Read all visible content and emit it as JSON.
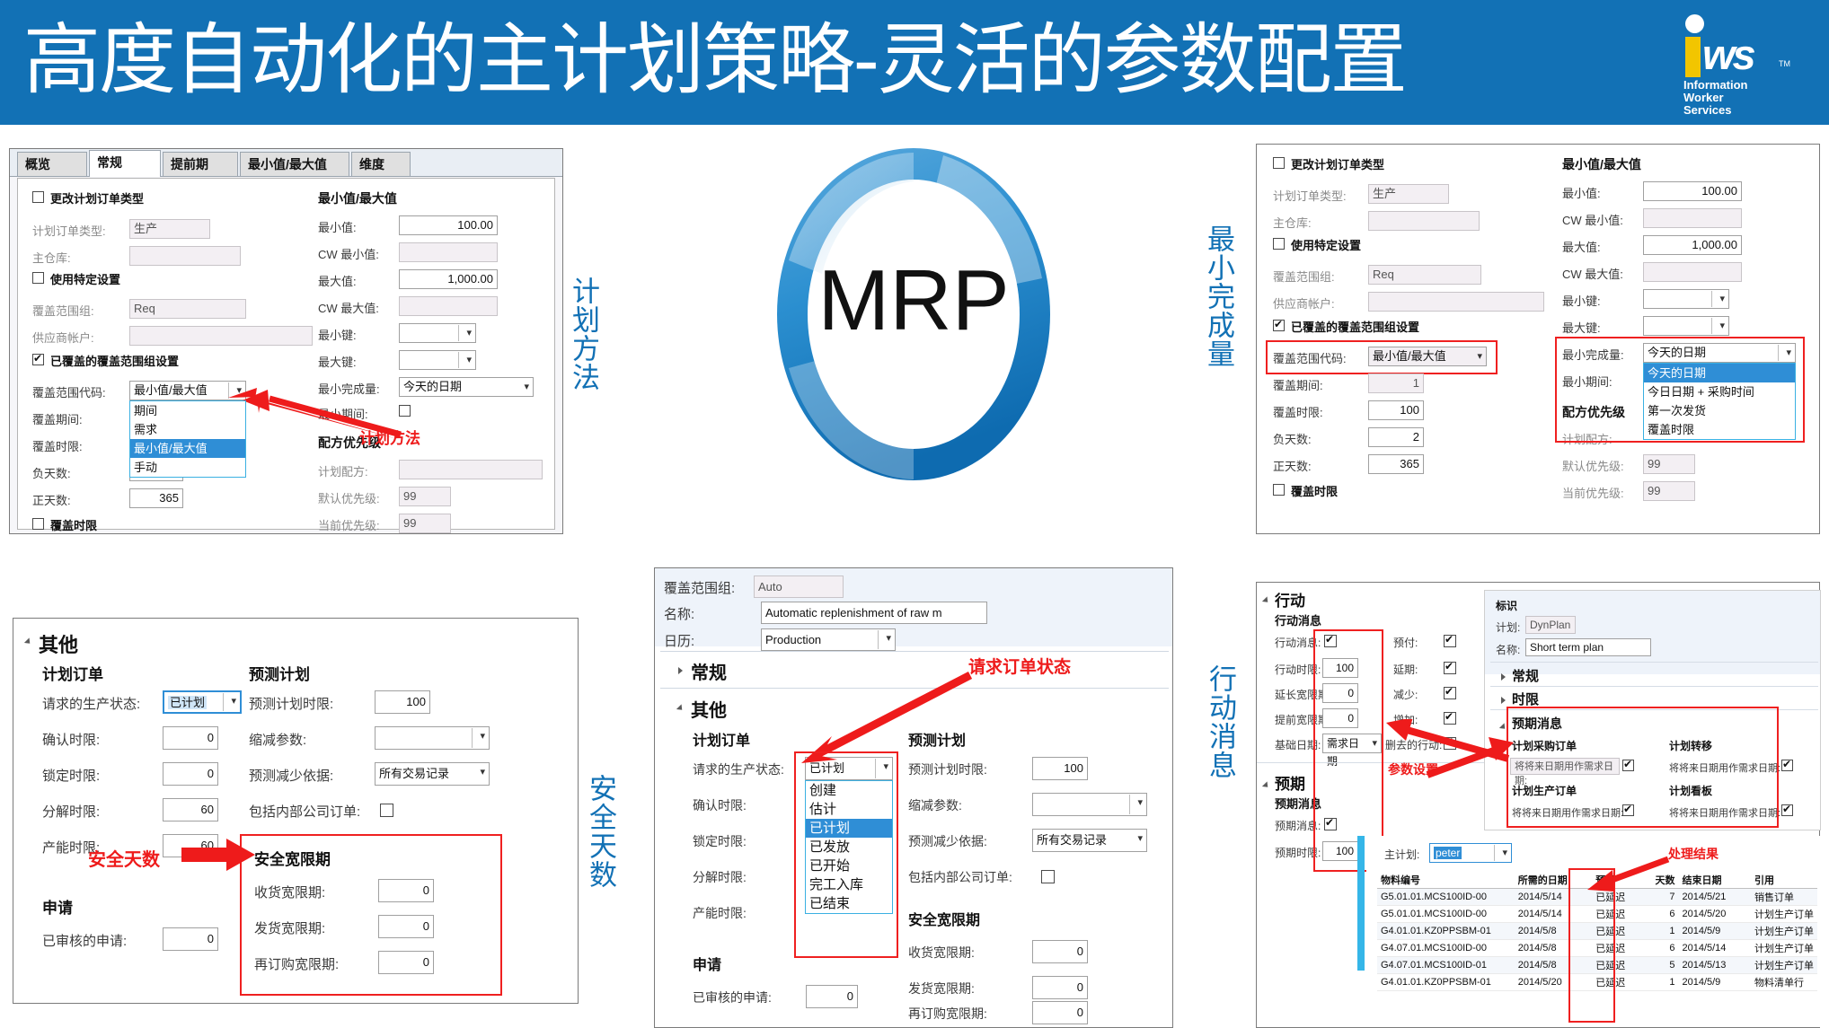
{
  "header": {
    "title": "高度自动化的主计划策略-灵活的参数配置",
    "logo": {
      "mark": "iWS",
      "tm": "TM",
      "line1": "Information",
      "line2": "Worker",
      "line3": "Services"
    },
    "brand_color": "#1271b5",
    "accent_color": "#f2c500"
  },
  "center_graphic": {
    "label": "MRP",
    "ring_color": "#1e87c8"
  },
  "vertical_labels": {
    "planning_method": "计划方法",
    "min_completion": "最小完成量",
    "safety_days": "安全天数",
    "action_message": "行动消息"
  },
  "panel_coverage_general": {
    "tabs": [
      {
        "label": "概览",
        "active": false
      },
      {
        "label": "常规",
        "active": true
      },
      {
        "label": "提前期",
        "active": false
      },
      {
        "label": "最小值/最大值",
        "active": false
      },
      {
        "label": "维度",
        "active": false
      }
    ],
    "change_order_type": {
      "label": "更改计划订单类型",
      "checked": false
    },
    "fields": [
      {
        "label": "计划订单类型:",
        "value": "生产",
        "readonly": true
      },
      {
        "label": "主仓库:",
        "value": "",
        "readonly": true
      }
    ],
    "use_specific": {
      "label": "使用特定设置",
      "checked": false
    },
    "fields2": [
      {
        "label": "覆盖范围组:",
        "value": "Req",
        "readonly": true
      },
      {
        "label": "供应商帐户:",
        "value": "",
        "readonly": true
      }
    ],
    "overridden_group": {
      "label": "已覆盖的覆盖范围组设置",
      "checked": true
    },
    "coverage_code": {
      "label": "覆盖范围代码:",
      "value": "最小值/最大值",
      "options": [
        "期间",
        "需求",
        "最小值/最大值",
        "手动"
      ],
      "selected": "最小值/最大值"
    },
    "left_rows": [
      {
        "label": "覆盖期间:",
        "value": ""
      },
      {
        "label": "覆盖时限:",
        "value": ""
      },
      {
        "label": "负天数:",
        "value": ""
      },
      {
        "label": "正天数:",
        "value": "365"
      }
    ],
    "coverage_time_fence": {
      "label": "覆盖时限",
      "checked": false
    },
    "minmax_title": "最小值/最大值",
    "minmax_rows": [
      {
        "label": "最小值:",
        "value": "100.00",
        "readonly": false
      },
      {
        "label": "CW 最小值:",
        "value": "",
        "readonly": true
      },
      {
        "label": "最大值:",
        "value": "1,000.00",
        "readonly": false
      },
      {
        "label": "CW 最大值:",
        "value": "",
        "readonly": true
      }
    ],
    "minmax_combos": [
      {
        "label": "最小键:",
        "value": ""
      },
      {
        "label": "最大键:",
        "value": ""
      }
    ],
    "min_completion": {
      "label": "最小完成量:",
      "value": "今天的日期"
    },
    "min_period": {
      "label": "最小期间:",
      "checked": false
    },
    "recipe_title": "配方优先级",
    "recipe_rows": [
      {
        "label": "计划配方:",
        "value": "",
        "readonly": true
      },
      {
        "label": "默认优先级:",
        "value": "99",
        "readonly": true
      },
      {
        "label": "当前优先级:",
        "value": "99",
        "readonly": true
      }
    ],
    "annotation": "计划方法"
  },
  "panel_min_completion": {
    "change_order_type": {
      "label": "更改计划订单类型",
      "checked": false
    },
    "fields": [
      {
        "label": "计划订单类型:",
        "value": "生产",
        "readonly": true
      },
      {
        "label": "主仓库:",
        "value": "",
        "readonly": true
      }
    ],
    "use_specific": {
      "label": "使用特定设置",
      "checked": false
    },
    "fields2": [
      {
        "label": "覆盖范围组:",
        "value": "Req",
        "readonly": true
      },
      {
        "label": "供应商帐户:",
        "value": "",
        "readonly": true
      }
    ],
    "overridden_group": {
      "label": "已覆盖的覆盖范围组设置",
      "checked": true
    },
    "coverage_code": {
      "label": "覆盖范围代码:",
      "value": "最小值/最大值"
    },
    "left_rows": [
      {
        "label": "覆盖期间:",
        "value": "1",
        "readonly": true
      },
      {
        "label": "覆盖时限:",
        "value": "100",
        "readonly": false
      },
      {
        "label": "负天数:",
        "value": "2",
        "readonly": false
      },
      {
        "label": "正天数:",
        "value": "365",
        "readonly": false
      }
    ],
    "coverage_time_fence": {
      "label": "覆盖时限",
      "checked": false
    },
    "minmax_title": "最小值/最大值",
    "minmax_rows": [
      {
        "label": "最小值:",
        "value": "100.00",
        "readonly": false
      },
      {
        "label": "CW 最小值:",
        "value": "",
        "readonly": true
      },
      {
        "label": "最大值:",
        "value": "1,000.00",
        "readonly": false
      },
      {
        "label": "CW 最大值:",
        "value": "",
        "readonly": true
      }
    ],
    "minmax_combos": [
      {
        "label": "最小键:",
        "value": ""
      },
      {
        "label": "最大键:",
        "value": ""
      }
    ],
    "min_completion": {
      "label": "最小完成量:",
      "value": "今天的日期",
      "options": [
        "今天的日期",
        "今日日期 + 采购时间",
        "第一次发货",
        "覆盖时限"
      ],
      "selected": "今天的日期"
    },
    "min_period": {
      "label": "最小期间:"
    },
    "recipe_title": "配方优先级",
    "recipe_rows": [
      {
        "label": "计划配方:",
        "value": "",
        "readonly": true
      },
      {
        "label": "默认优先级:",
        "value": "99",
        "readonly": true
      },
      {
        "label": "当前优先级:",
        "value": "99",
        "readonly": true
      }
    ]
  },
  "panel_safety_days": {
    "group_title": "其他",
    "col1_title": "计划订单",
    "col2_title": "预测计划",
    "planned_order": [
      {
        "label": "请求的生产状态:",
        "value": "已计划",
        "type": "combo"
      },
      {
        "label": "确认时限:",
        "value": "0",
        "type": "num"
      },
      {
        "label": "锁定时限:",
        "value": "0",
        "type": "num"
      },
      {
        "label": "分解时限:",
        "value": "60",
        "type": "num"
      },
      {
        "label": "产能时限:",
        "value": "60",
        "type": "num"
      }
    ],
    "forecast_plan": [
      {
        "label": "预测计划时限:",
        "value": "100",
        "type": "num"
      },
      {
        "label": "缩减参数:",
        "value": "",
        "type": "combo"
      },
      {
        "label": "预测减少依据:",
        "value": "所有交易记录",
        "type": "combo"
      }
    ],
    "include_intercompany": {
      "label": "包括内部公司订单:",
      "checked": false
    },
    "request_title": "申请",
    "request_rows": [
      {
        "label": "已审核的申请:",
        "value": "0"
      }
    ],
    "safety_title": "安全宽限期",
    "safety_rows": [
      {
        "label": "收货宽限期:",
        "value": "0"
      },
      {
        "label": "发货宽限期:",
        "value": "0"
      },
      {
        "label": "再订购宽限期:",
        "value": "0"
      }
    ],
    "annotation": "安全天数"
  },
  "panel_order_status": {
    "header_rows": [
      {
        "label": "覆盖范围组:",
        "value": "Auto",
        "readonly": true
      },
      {
        "label": "名称:",
        "value": "Automatic replenishment of raw m",
        "readonly": false
      },
      {
        "label": "日历:",
        "value": "Production",
        "type": "combo"
      }
    ],
    "section_general": "常规",
    "section_other": "其他",
    "col1_title": "计划订单",
    "col2_title": "预测计划",
    "production_status": {
      "label": "请求的生产状态:",
      "value": "已计划",
      "options": [
        "创建",
        "估计",
        "已计划",
        "已发放",
        "已开始",
        "完工入库",
        "已结束"
      ],
      "selected": "已计划"
    },
    "planned_order_rest": [
      {
        "label": "确认时限:"
      },
      {
        "label": "锁定时限:"
      },
      {
        "label": "分解时限:"
      },
      {
        "label": "产能时限:"
      }
    ],
    "forecast_plan": [
      {
        "label": "预测计划时限:",
        "value": "100",
        "type": "num"
      },
      {
        "label": "缩减参数:",
        "value": "",
        "type": "combo"
      },
      {
        "label": "预测减少依据:",
        "value": "所有交易记录",
        "type": "combo"
      }
    ],
    "include_intercompany": {
      "label": "包括内部公司订单:",
      "checked": false
    },
    "request_title": "申请",
    "request_rows": [
      {
        "label": "已审核的申请:",
        "value": "0"
      }
    ],
    "safety_title": "安全宽限期",
    "safety_rows": [
      {
        "label": "收货宽限期:",
        "value": "0"
      },
      {
        "label": "发货宽限期:",
        "value": "0"
      },
      {
        "label": "再订购宽限期:",
        "value": "0"
      }
    ],
    "annotation": "请求订单状态"
  },
  "panel_action_message": {
    "action_section": "行动",
    "action_sub": "行动消息",
    "action_left": [
      {
        "label": "行动消息:",
        "value": "",
        "type": "check",
        "checked": true
      },
      {
        "label": "行动时限:",
        "value": "100",
        "type": "num"
      },
      {
        "label": "延长宽限期:",
        "value": "0",
        "type": "num"
      },
      {
        "label": "提前宽限期:",
        "value": "0",
        "type": "num"
      },
      {
        "label": "基础日期:",
        "value": "需求日期",
        "type": "combo"
      }
    ],
    "action_right": [
      {
        "label": "预付:",
        "checked": true
      },
      {
        "label": "延期:",
        "checked": true
      },
      {
        "label": "减少:",
        "checked": true
      },
      {
        "label": "增加:",
        "checked": true
      },
      {
        "label": "删去的行动:",
        "checked": true
      }
    ],
    "expect_section": "预期",
    "expect_sub": "预期消息",
    "expect_rows": [
      {
        "label": "预期消息:",
        "type": "check",
        "checked": true
      },
      {
        "label": "预期时限:",
        "value": "100",
        "type": "num"
      }
    ],
    "annotation_params": "参数设置",
    "annotation_result": "处理结果",
    "id_panel": {
      "title": "标识",
      "plan": {
        "label": "计划:",
        "value": "DynPlan",
        "readonly": true
      },
      "name": {
        "label": "名称:",
        "value": "Short term plan",
        "readonly": false
      },
      "sections": [
        "常规",
        "时限"
      ],
      "expected_title": "预期消息",
      "groups": [
        {
          "title": "计划采购订单",
          "row": "将将来日期用作需求日期:",
          "checked": true
        },
        {
          "title": "计划转移",
          "row": "将将来日期用作需求日期:",
          "checked": true
        },
        {
          "title": "计划生产订单",
          "row": "将将来日期用作需求日期:",
          "checked": true
        },
        {
          "title": "计划看板",
          "row": "将将来日期用作需求日期:",
          "checked": true
        }
      ]
    },
    "grid": {
      "master_plan": {
        "label": "主计划:",
        "value": "peter"
      },
      "columns": [
        "物料编号",
        "所需的日期",
        "预期",
        "天数",
        "结束日期",
        "引用"
      ],
      "rows": [
        [
          "G5.01.01.MCS100ID-00",
          "2014/5/14",
          "已延迟",
          "7",
          "2014/5/21",
          "销售订单"
        ],
        [
          "G5.01.01.MCS100ID-00",
          "2014/5/14",
          "已延迟",
          "6",
          "2014/5/20",
          "计划生产订单"
        ],
        [
          "G4.01.01.KZ0PPSBM-01",
          "2014/5/8",
          "已延迟",
          "1",
          "2014/5/9",
          "计划生产订单"
        ],
        [
          "G4.07.01.MCS100ID-00",
          "2014/5/8",
          "已延迟",
          "6",
          "2014/5/14",
          "计划生产订单"
        ],
        [
          "G4.07.01.MCS100ID-01",
          "2014/5/8",
          "已延迟",
          "5",
          "2014/5/13",
          "计划生产订单"
        ],
        [
          "G4.01.01.KZ0PPSBM-01",
          "2014/5/20",
          "已延迟",
          "1",
          "2014/5/9",
          "物料清单行"
        ]
      ]
    }
  }
}
